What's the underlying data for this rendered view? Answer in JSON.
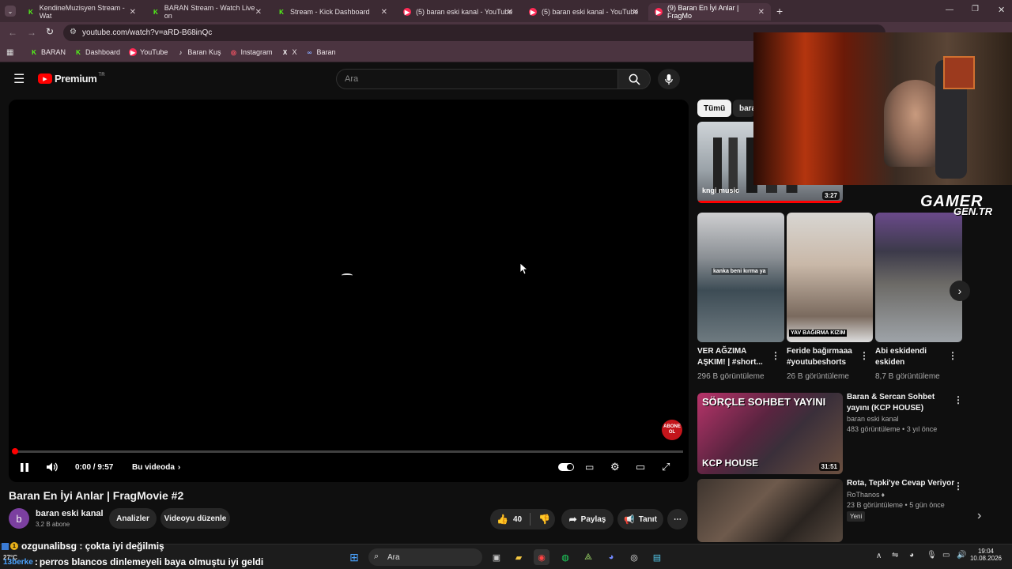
{
  "browser": {
    "tabs": [
      {
        "label": "KendineMuzisyen Stream - Wat",
        "icon": "kick-icon",
        "active": false
      },
      {
        "label": "BARAN Stream - Watch Live on",
        "icon": "kick-icon",
        "active": false
      },
      {
        "label": "Stream - Kick Dashboard",
        "icon": "kick-icon",
        "active": false
      },
      {
        "label": "(5) baran eski kanal - YouTube",
        "icon": "youtube-icon",
        "active": false
      },
      {
        "label": "(5) baran eski kanal - YouTube",
        "icon": "youtube-icon",
        "active": false
      },
      {
        "label": "(9) Baran En İyi Anlar | FragMo",
        "icon": "youtube-icon",
        "active": true
      }
    ],
    "url": "youtube.com/watch?v=aRD-B68inQc",
    "bookmarks": [
      "BARAN",
      "Dashboard",
      "YouTube",
      "Baran Kuş",
      "Instagram",
      "X",
      "Baran"
    ]
  },
  "youtube": {
    "logo": "Premium",
    "logo_region": "TR",
    "search_placeholder": "Ara",
    "player": {
      "time": "0:00 / 9:57",
      "chapter": "Bu videoda",
      "progress": 0.0,
      "subscribe_badge": "ABONE OL"
    },
    "video": {
      "title": "Baran En İyi Anlar | FragMovie #2",
      "channel": "baran eski kanal",
      "avatar_letter": "b",
      "subscribers": "3,2 B abone",
      "analytics_button": "Analizler",
      "edit_button": "Videoyu düzenle",
      "likes": "40",
      "share": "Paylaş",
      "promote": "Tanıt"
    },
    "chips": [
      "Tümü",
      "bara"
    ],
    "top_video": {
      "duration": "3:27",
      "overlay": "kngi music"
    },
    "shorts": [
      {
        "title": "VER AĞZIMA AŞKIM! | #short...",
        "views": "296 B görüntüleme",
        "caption": "kanka beni kırma ya"
      },
      {
        "title": "Feride bağırmaaa #youtubeshorts",
        "views": "26 B görüntüleme",
        "caption": "YAV BAĞIRMA KIZIM"
      },
      {
        "title": "Abi eskidendi eskiden",
        "views": "8,7 B görüntüleme",
        "caption": ""
      }
    ],
    "recommendations": [
      {
        "title": "Baran & Sercan Sohbet yayını (KCP HOUSE)",
        "channel": "baran eski kanal",
        "meta": "483 görüntüleme • 3 yıl önce",
        "duration": "31:51",
        "thumb_top": "SÖRÇLE SOHBET YAYINI",
        "thumb_bottom": "KCP HOUSE"
      },
      {
        "title": "Rota, Tepki'ye Cevap Veriyor",
        "channel": "RoThanos",
        "meta": "23 B görüntüleme • 5 gün önce",
        "badge": "Yeni"
      }
    ]
  },
  "stream_overlay": {
    "brand_line1": "GAMER",
    "brand_line2": "GEN.TR"
  },
  "chat": [
    {
      "user": "ozgunalibsg",
      "text": "çokta iyi değilmiş"
    },
    {
      "user": "13berke",
      "text": "perros blancos dinlemeyeli baya olmuştu iyi geldi"
    }
  ],
  "taskbar": {
    "search": "Ara",
    "weather": "27°C",
    "time": "19:04",
    "date": "10.08.2026"
  },
  "colors": {
    "accent": "#ff0000",
    "chrome": "#4b3440",
    "kick": "#53fc18"
  }
}
